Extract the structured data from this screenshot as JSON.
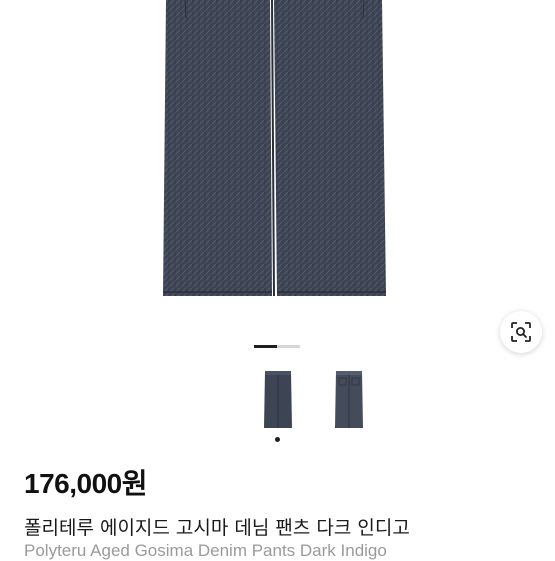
{
  "product": {
    "price": "176,000원",
    "title_ko": "폴리테루 에이지드 고시마 데님 팬츠 다크 인디고",
    "title_en": "Polyteru Aged Gosima Denim Pants Dark Indigo"
  },
  "gallery": {
    "image_subject": "dark indigo denim pants",
    "thumbnails": [
      "denim pants front",
      "denim pants back"
    ],
    "selected_index": 0,
    "lens_icon": "image-search-icon"
  },
  "colors": {
    "denim": "#3c4352",
    "denim_light": "#5a6170",
    "text": "#111111",
    "subtext": "#9a9a9a"
  }
}
